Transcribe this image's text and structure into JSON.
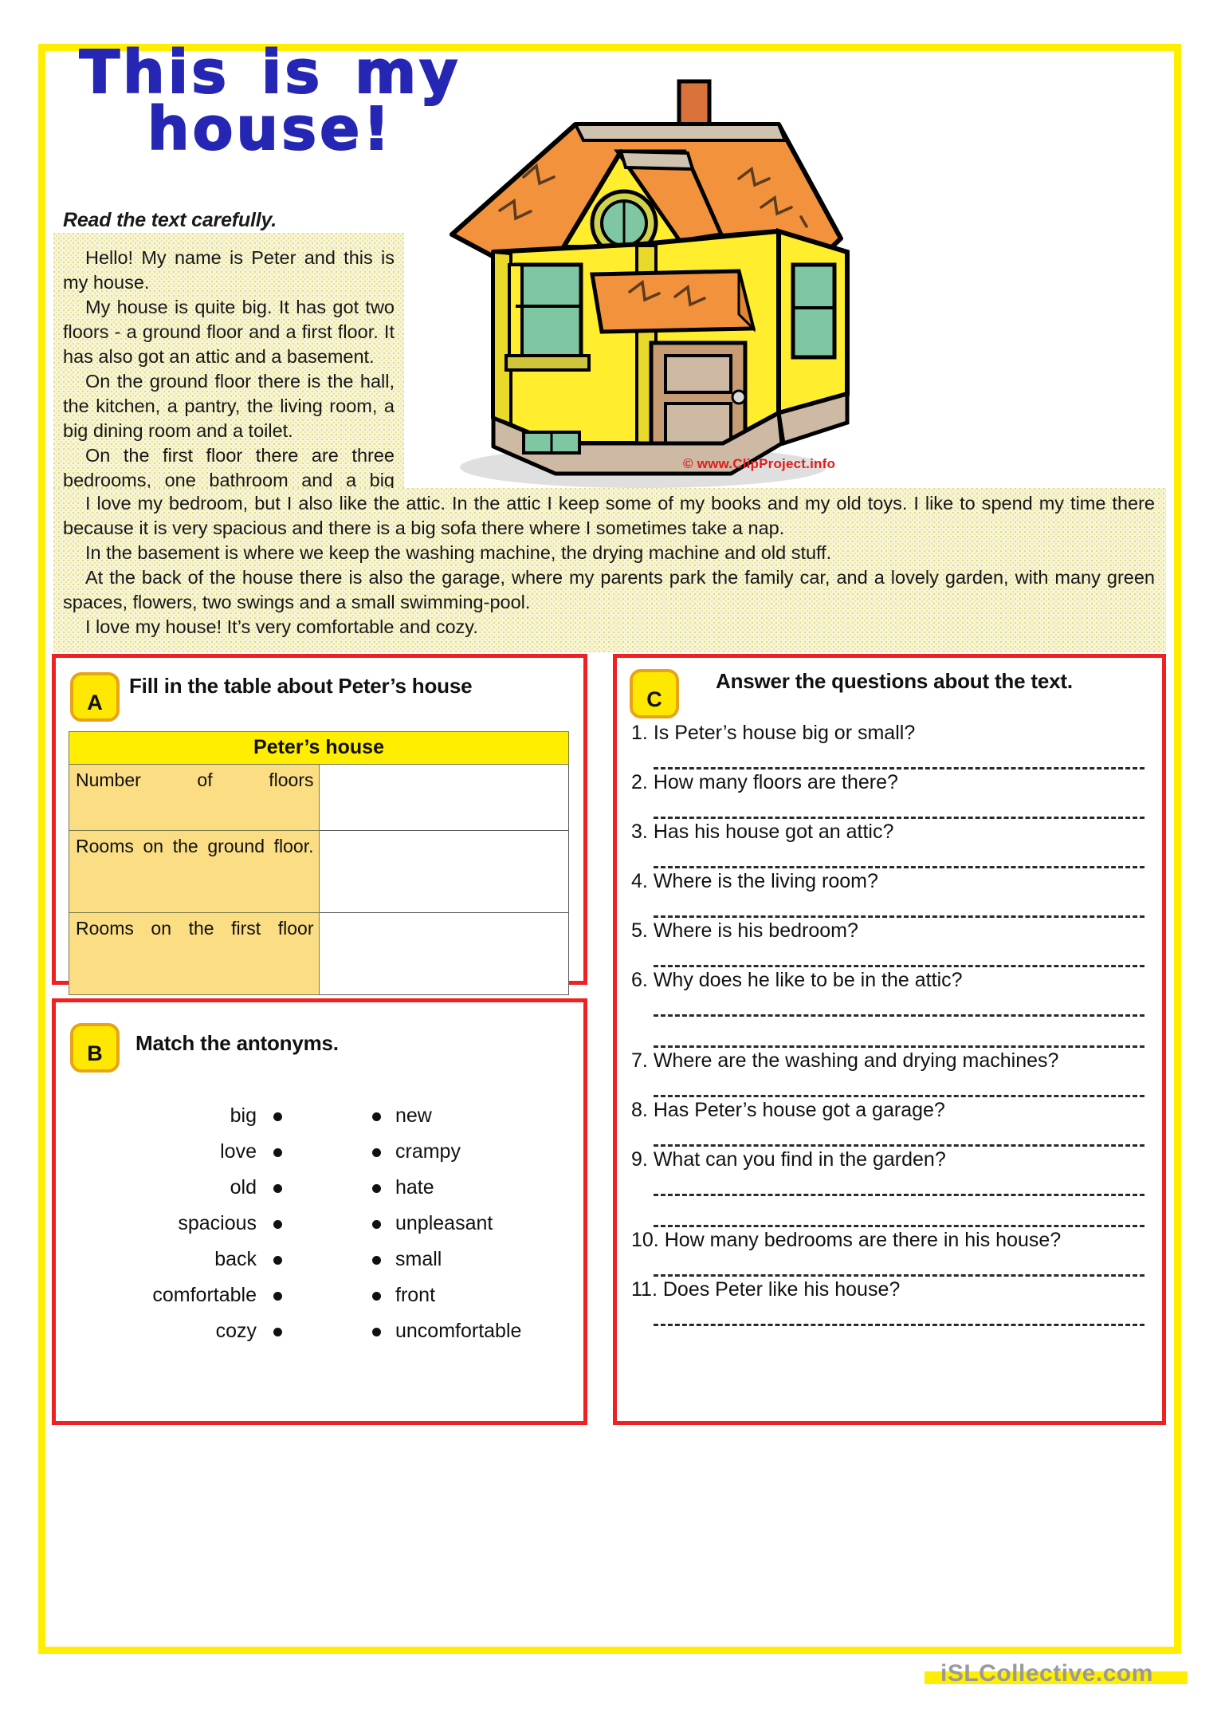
{
  "title": "This is my house!",
  "instruction": "Read the text carefully.",
  "credit": "© www.ClipProject.info",
  "footer": "iSLCollective.com",
  "reading": {
    "column_paragraphs": [
      "Hello! My name is Peter and this is my house.",
      "My house is quite big. It has got two floors - a ground floor and a first floor. It has also got an attic and a basement.",
      "On the ground floor there is the hall, the kitchen, a pantry, the living room, a big dining room and a toilet.",
      "On the first floor there are three bedrooms, one bathroom and a big corridor. My bedroom is between my parents’ bedroom and the bathroom. My sister’s bedroom is in front of mine."
    ],
    "wide_paragraphs": [
      "I love my bedroom, but I also like the attic. In the attic I keep some of my books and my old toys. I like to spend my time there because it is very spacious and there is a big sofa there where I sometimes take a nap.",
      "In the basement is where we keep the washing machine, the drying machine and old stuff.",
      "At the back of the house there is also the garage, where my parents park the family car, and a lovely garden, with many green spaces, flowers, two swings and a small swimming-pool.",
      "I love my house! It’s very comfortable and cozy."
    ]
  },
  "exercise_a": {
    "letter": "A",
    "heading": "Fill in the table about Peter’s house",
    "table": {
      "title": "Peter’s house",
      "rows": [
        {
          "label": "Number of floors",
          "value": ""
        },
        {
          "label": "Rooms on the ground floor.",
          "value": ""
        },
        {
          "label": "Rooms on the first floor",
          "value": ""
        }
      ]
    }
  },
  "exercise_b": {
    "letter": "B",
    "heading": "Match the antonyms.",
    "left_words": [
      "big",
      "love",
      "old",
      "spacious",
      "back",
      "comfortable",
      "cozy"
    ],
    "right_words": [
      "new",
      "crampy",
      "hate",
      "unpleasant",
      "small",
      "front",
      "uncomfortable"
    ]
  },
  "exercise_c": {
    "letter": "C",
    "heading": "Answer the questions about the text.",
    "questions": [
      {
        "number": "1.",
        "text": "Is Peter’s house big or small?",
        "lines": 1
      },
      {
        "number": "2.",
        "text": "How many floors are there?",
        "lines": 1
      },
      {
        "number": "3.",
        "text": "Has his house got an attic?",
        "lines": 1
      },
      {
        "number": "4.",
        "text": "Where is the living room?",
        "lines": 1
      },
      {
        "number": "5.",
        "text": "Where is his bedroom?",
        "lines": 1
      },
      {
        "number": "6.",
        "text": "Why does he like to be in the attic?",
        "lines": 2
      },
      {
        "number": "7.",
        "text": "Where are the washing and drying machines?",
        "lines": 1
      },
      {
        "number": "8.",
        "text": "Has Peter’s house got a garage?",
        "lines": 1
      },
      {
        "number": "9.",
        "text": "What can you find in the garden?",
        "lines": 2
      },
      {
        "number": "10.",
        "text": "How many bedrooms are there in his house?",
        "lines": 1
      },
      {
        "number": "11.",
        "text": "Does Peter like his house?",
        "lines": 1
      }
    ]
  },
  "colors": {
    "frame_yellow": "#ffee00",
    "title_blue": "#2626b5",
    "box_red": "#ee2222",
    "badge_yellow": "#ffe800",
    "badge_border": "#e8a317",
    "table_header": "#ffee00",
    "table_label": "#fbdd83",
    "text_bg": "#f7f5d3",
    "credit_red": "#e21b1b",
    "footer_gray": "#9a9a9a"
  }
}
